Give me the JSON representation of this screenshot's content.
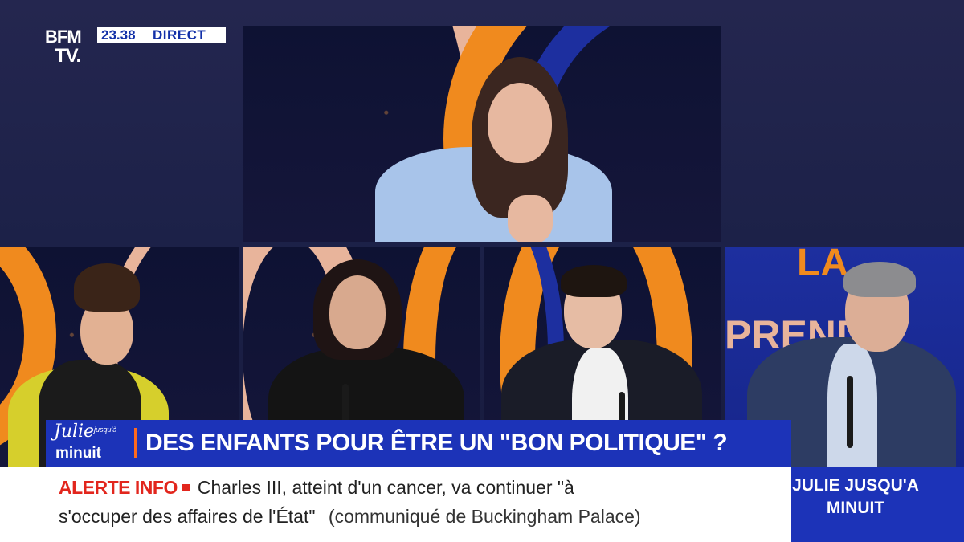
{
  "channel": {
    "logo_line1": "BFM",
    "logo_line2": "TV.",
    "time": "23.38",
    "live_label": "DIRECT"
  },
  "show": {
    "logo_word": "Julie",
    "logo_small": "jusqu'à",
    "logo_word2": "minuit",
    "name_line1": "JULIE JUSQU'A",
    "name_line2": "MINUIT"
  },
  "headline": {
    "text": "DES ENFANTS POUR ÊTRE UN \"BON POLITIQUE\" ?"
  },
  "ticker": {
    "alert_label": "ALERTE INFO",
    "line1": "Charles III, atteint d'un cancer, va continuer \"à",
    "line2": "s'occuper des affaires de l'État\"",
    "source": "(communiqué de Buckingham Palace)"
  },
  "background_set": {
    "letters_row1": "LA",
    "letters_row2": "PREND"
  },
  "colors": {
    "brand_blue": "#1c33b8",
    "alert_red": "#e2261d",
    "accent_orange": "#ff6a1f"
  }
}
